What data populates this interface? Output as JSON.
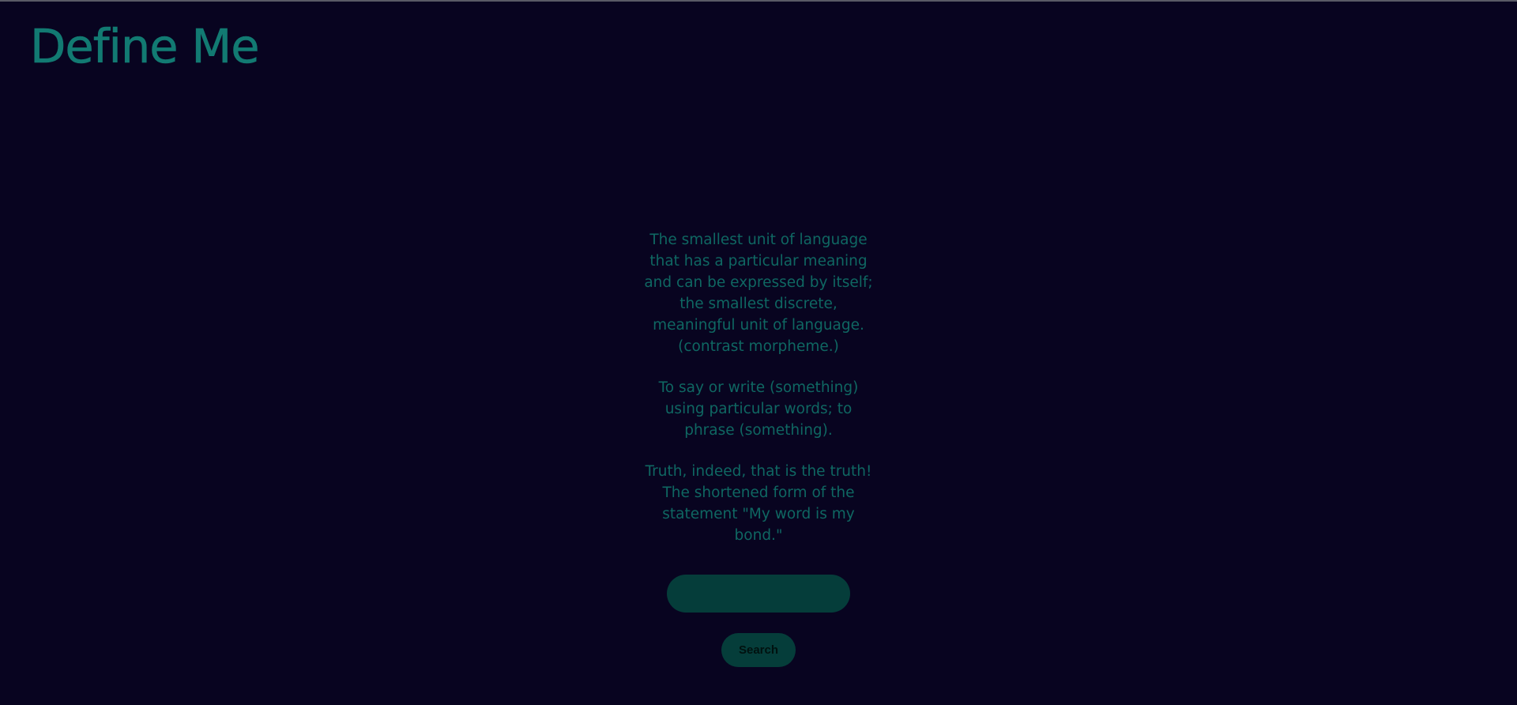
{
  "app": {
    "title": "Define Me"
  },
  "definitions": [
    "The smallest unit of language that has a particular meaning and can be expressed by itself; the smallest discrete, meaningful unit of language. (contrast morpheme.)",
    "To say or write (something) using particular words; to phrase (something).",
    "Truth, indeed, that is the truth! The shortened form of the statement \"My word is my bond.\""
  ],
  "search": {
    "value": "",
    "placeholder": "",
    "button_label": "Search"
  },
  "colors": {
    "background": "#080420",
    "title": "#127a72",
    "text": "#0f6762",
    "control": "#053d3a"
  }
}
